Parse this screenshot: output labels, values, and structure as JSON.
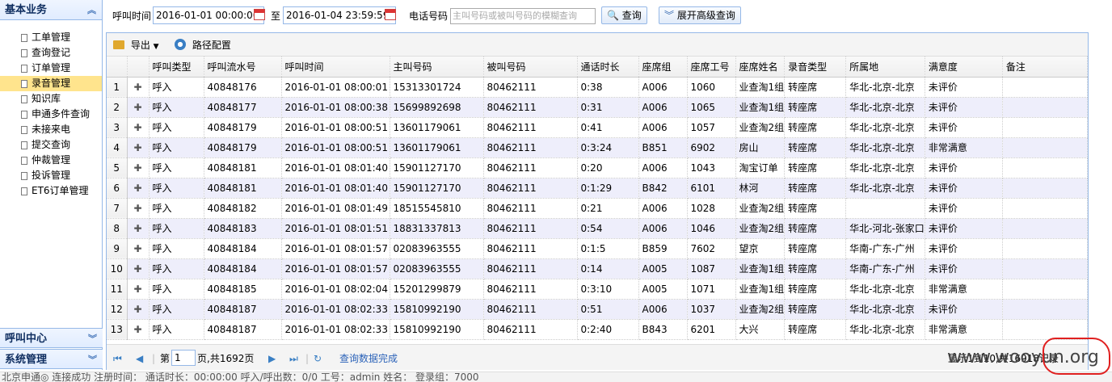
{
  "sidebar": {
    "header": "基本业务",
    "items": [
      "工单管理",
      "查询登记",
      "订单管理",
      "录音管理",
      "知识库",
      "申通多件查询",
      "未接来电",
      "提交查询",
      "仲裁管理",
      "投诉管理",
      "ET6订单管理"
    ],
    "active_index": 3,
    "call_center": "呼叫中心",
    "system": "系统管理"
  },
  "search": {
    "call_time_label": "呼叫时间",
    "start": "2016-01-01 00:00:00",
    "to_label": "至",
    "end": "2016-01-04 23:59:59",
    "phone_label": "电话号码",
    "phone_placeholder": "主叫号码或被叫号码的模糊查询",
    "query_button": "查询",
    "advanced_button": "展开高级查询"
  },
  "toolbar": {
    "export": "导出",
    "path_config": "路径配置"
  },
  "table": {
    "columns": [
      "呼叫类型",
      "呼叫流水号",
      "呼叫时间",
      "主叫号码",
      "被叫号码",
      "通话时长",
      "座席组",
      "座席工号",
      "座席姓名",
      "录音类型",
      "所属地",
      "满意度",
      "备注"
    ],
    "rows": [
      [
        "1",
        "呼入",
        "40848176",
        "2016-01-01 08:00:01",
        "15313301724",
        "80462111",
        "0:38",
        "A006",
        "1060",
        "业查淘1组",
        "转座席",
        "华北-北京-北京",
        "未评价",
        ""
      ],
      [
        "2",
        "呼入",
        "40848177",
        "2016-01-01 08:00:38",
        "15699892698",
        "80462111",
        "0:31",
        "A006",
        "1065",
        "业查淘1组",
        "转座席",
        "华北-北京-北京",
        "未评价",
        ""
      ],
      [
        "3",
        "呼入",
        "40848179",
        "2016-01-01 08:00:51",
        "13601179061",
        "80462111",
        "0:41",
        "A006",
        "1057",
        "业查淘2组",
        "转座席",
        "华北-北京-北京",
        "未评价",
        ""
      ],
      [
        "4",
        "呼入",
        "40848179",
        "2016-01-01 08:00:51",
        "13601179061",
        "80462111",
        "0:3:24",
        "B851",
        "6902",
        "房山",
        "转座席",
        "华北-北京-北京",
        "非常满意",
        ""
      ],
      [
        "5",
        "呼入",
        "40848181",
        "2016-01-01 08:01:40",
        "15901127170",
        "80462111",
        "0:20",
        "A006",
        "1043",
        "淘宝订单",
        "转座席",
        "华北-北京-北京",
        "未评价",
        ""
      ],
      [
        "6",
        "呼入",
        "40848181",
        "2016-01-01 08:01:40",
        "15901127170",
        "80462111",
        "0:1:29",
        "B842",
        "6101",
        "林河",
        "转座席",
        "华北-北京-北京",
        "未评价",
        ""
      ],
      [
        "7",
        "呼入",
        "40848182",
        "2016-01-01 08:01:49",
        "18515545810",
        "80462111",
        "0:21",
        "A006",
        "1028",
        "业查淘2组",
        "转座席",
        "",
        "未评价",
        ""
      ],
      [
        "8",
        "呼入",
        "40848183",
        "2016-01-01 08:01:51",
        "18831337813",
        "80462111",
        "0:54",
        "A006",
        "1046",
        "业查淘2组",
        "转座席",
        "华北-河北-张家口",
        "未评价",
        ""
      ],
      [
        "9",
        "呼入",
        "40848184",
        "2016-01-01 08:01:57",
        "02083963555",
        "80462111",
        "0:1:5",
        "B859",
        "7602",
        "望京",
        "转座席",
        "华南-广东-广州",
        "未评价",
        ""
      ],
      [
        "10",
        "呼入",
        "40848184",
        "2016-01-01 08:01:57",
        "02083963555",
        "80462111",
        "0:14",
        "A005",
        "1087",
        "业查淘1组",
        "转座席",
        "华南-广东-广州",
        "未评价",
        ""
      ],
      [
        "11",
        "呼入",
        "40848185",
        "2016-01-01 08:02:04",
        "15201299879",
        "80462111",
        "0:3:10",
        "A005",
        "1071",
        "业查淘1组",
        "转座席",
        "华北-北京-北京",
        "非常满意",
        ""
      ],
      [
        "12",
        "呼入",
        "40848187",
        "2016-01-01 08:02:33",
        "15810992190",
        "80462111",
        "0:51",
        "A006",
        "1037",
        "业查淘2组",
        "转座席",
        "华北-北京-北京",
        "未评价",
        ""
      ],
      [
        "13",
        "呼入",
        "40848187",
        "2016-01-01 08:02:33",
        "15810992190",
        "80462111",
        "0:2:40",
        "B843",
        "6201",
        "大兴",
        "转座席",
        "华北-北京-北京",
        "非常满意",
        ""
      ]
    ]
  },
  "pager": {
    "page_label_before": "第",
    "page": "1",
    "page_label_after": "页,共1692页",
    "status": "查询数据完成",
    "info": "显示1到10,共16918记录"
  },
  "statusbar": {
    "text": "北京申通◎  连接成功  注册时间：  通话时长：00:00:00  呼入/呼出数：0/0  工号：admin  姓名：  登录组：7000"
  },
  "watermark": "www.wooyun.org"
}
